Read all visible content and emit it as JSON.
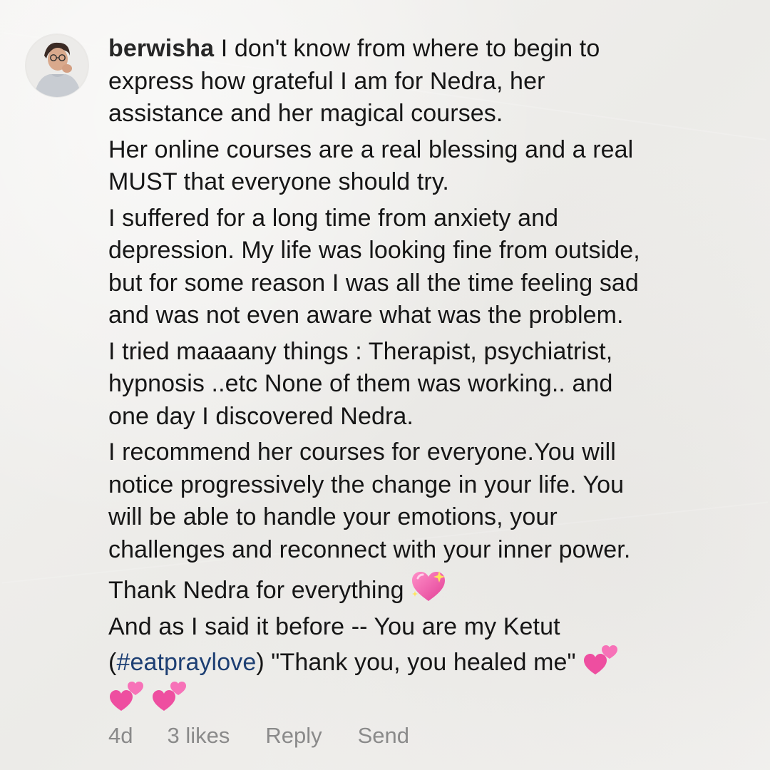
{
  "comment": {
    "username": "berwisha",
    "avatar_icon": "profile-photo-avatar",
    "paragraphs": [
      {
        "lines": [
          " I don't know from where to begin to",
          "express how grateful I am for Nedra, her",
          "assistance and her magical courses."
        ]
      },
      {
        "lines": [
          "Her online courses are a real blessing and a real",
          "MUST that everyone should try."
        ]
      },
      {
        "lines": [
          "I suffered for a long time from anxiety and",
          "depression. My life was looking fine from outside,",
          "but for some reason I was all the time feeling sad",
          "and was not even aware what was the problem."
        ]
      },
      {
        "lines": [
          "I tried maaaany things : Therapist, psychiatrist,",
          "hypnosis ..etc None of them was working.. and",
          "one day I discovered Nedra."
        ]
      },
      {
        "lines": [
          "I recommend her courses for everyone.You will",
          "notice progressively the change in your life. You",
          "will be able to handle your emotions, your",
          "challenges and reconnect with your inner power."
        ]
      },
      {
        "thank_text": "Thank Nedra for everything ",
        "thank_emoji": "sparkling-heart-icon"
      },
      {
        "line1": "And as I said it before -- You are my Ketut",
        "open_paren": "(",
        "hashtag": "#eatpraylove",
        "quote_text": ") \"Thank you, you healed me\" ",
        "closing_emojis": [
          "two-hearts-icon",
          "two-hearts-icon",
          "two-hearts-icon"
        ]
      }
    ],
    "meta": {
      "time": "4d",
      "likes": "3 likes",
      "reply": "Reply",
      "send": "Send"
    }
  },
  "colors": {
    "background": "#f2f1ef",
    "text": "#161616",
    "hashtag": "#1d3f73",
    "meta": "#8a8a8a",
    "heart_pink": "#f45aa8"
  }
}
